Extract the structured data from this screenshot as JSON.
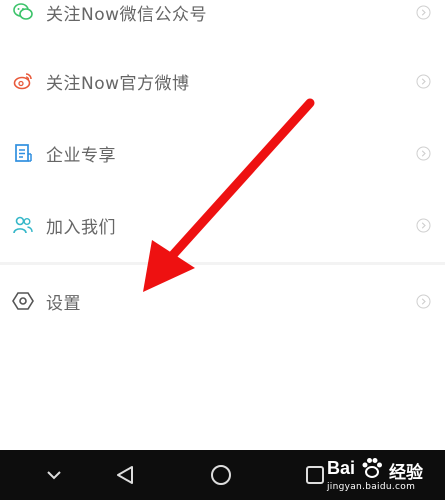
{
  "menu": {
    "items": [
      {
        "label": "关注Now微信公众号",
        "icon": "wechat-icon"
      },
      {
        "label": "关注Now官方微博",
        "icon": "weibo-icon"
      },
      {
        "label": "企业专享",
        "icon": "document-icon"
      },
      {
        "label": "加入我们",
        "icon": "people-icon"
      },
      {
        "label": "设置",
        "icon": "settings-hexagon-icon"
      }
    ]
  },
  "colors": {
    "wechat": "#3cc36a",
    "weibo": "#e8593a",
    "enterprise": "#2f8fe0",
    "join": "#35b7c8",
    "settings": "#555555",
    "arrow": "#ee1111",
    "navbar": "#0d0d0d"
  },
  "navbar": {
    "buttons": [
      "chevron-down-icon",
      "back-triangle-icon",
      "home-circle-icon",
      "recents-square-icon"
    ]
  },
  "watermark": {
    "brand": "Bai",
    "brand_suffix": "经验",
    "url": "jingyan.baidu.com"
  }
}
